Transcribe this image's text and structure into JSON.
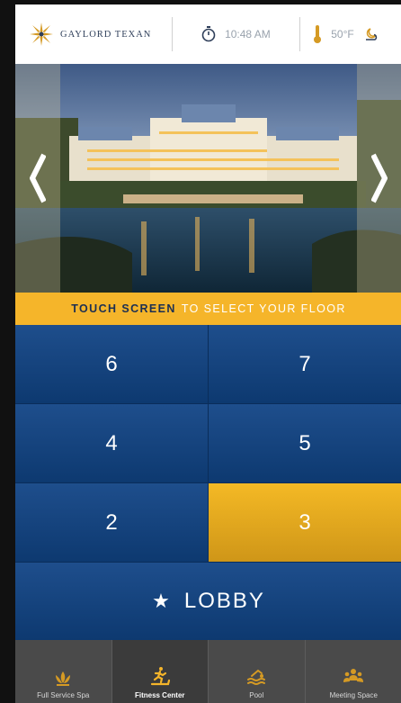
{
  "header": {
    "brand": "GAYLORD TEXAN",
    "time": "10:48 AM",
    "temperature": "50°F"
  },
  "icons": {
    "logo": "sun-star-logo",
    "clock": "stopwatch-icon",
    "thermometer": "thermometer-icon",
    "weather": "cloud-moon-icon",
    "prev": "chevron-left-icon",
    "next": "chevron-right-icon"
  },
  "banner": {
    "emphasis": "TOUCH SCREEN",
    "rest": "TO SELECT YOUR FLOOR"
  },
  "floors": [
    {
      "label": "6",
      "selected": false
    },
    {
      "label": "7",
      "selected": false
    },
    {
      "label": "4",
      "selected": false
    },
    {
      "label": "5",
      "selected": false
    },
    {
      "label": "2",
      "selected": false
    },
    {
      "label": "3",
      "selected": true
    }
  ],
  "lobby": {
    "star": "★",
    "label": "LOBBY"
  },
  "amenities": [
    {
      "label": "Full Service Spa",
      "icon": "lotus-icon",
      "active": false
    },
    {
      "label": "Fitness Center",
      "icon": "treadmill-runner-icon",
      "active": true
    },
    {
      "label": "Pool",
      "icon": "swimmer-icon",
      "active": false
    },
    {
      "label": "Meeting Space",
      "icon": "people-group-icon",
      "active": false
    }
  ],
  "colors": {
    "accent": "#f5b52a",
    "primary_blue": "#0f3d76",
    "banner_dark_text": "#1c2f52",
    "amenity_bar": "#4a4a4a"
  }
}
